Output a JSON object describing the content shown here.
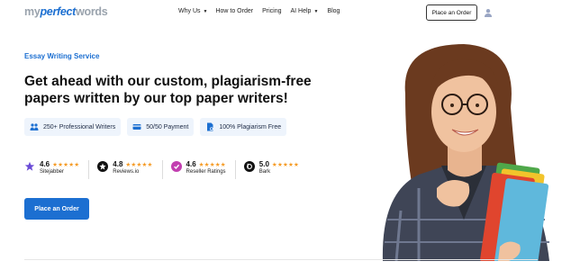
{
  "header": {
    "logo": {
      "part1": "my",
      "part2": "perfect",
      "part3": "words"
    },
    "nav": [
      {
        "label": "Why Us",
        "has_caret": true
      },
      {
        "label": "How to Order",
        "has_caret": false
      },
      {
        "label": "Pricing",
        "has_caret": false
      },
      {
        "label": "AI Help",
        "has_caret": true
      },
      {
        "label": "Blog",
        "has_caret": false
      }
    ],
    "order_button": "Place an Order",
    "user_icon": "user-icon"
  },
  "hero": {
    "eyebrow": "Essay Writing Service",
    "headline": "Get ahead with our custom, plagiarism-free papers written by our top paper writers!",
    "chips": [
      {
        "icon": "writers-icon",
        "label": "250+ Professional Writers"
      },
      {
        "icon": "payment-icon",
        "label": "50/50 Payment"
      },
      {
        "icon": "document-icon",
        "label": "100% Plagiarism Free"
      }
    ],
    "ratings": [
      {
        "icon": "sitejabber-logo",
        "score": "4.6",
        "stars": "★★★★★",
        "name": "Sitejabber",
        "color": "#6a4bd6"
      },
      {
        "icon": "reviewsio-logo",
        "score": "4.8",
        "stars": "★★★★★",
        "name": "Reviews.io",
        "color": "#111111"
      },
      {
        "icon": "resellerratings-logo",
        "score": "4.6",
        "stars": "★★★★★",
        "name": "Reseller Ratings",
        "color": "#c23fb0"
      },
      {
        "icon": "bark-logo",
        "score": "5.0",
        "stars": "★★★★★",
        "name": "Bark",
        "color": "#111111"
      }
    ],
    "cta": "Place an Order"
  },
  "colors": {
    "brand_blue": "#1c6fd1",
    "star": "#f59a23",
    "chip_bg": "#eef4fc"
  }
}
